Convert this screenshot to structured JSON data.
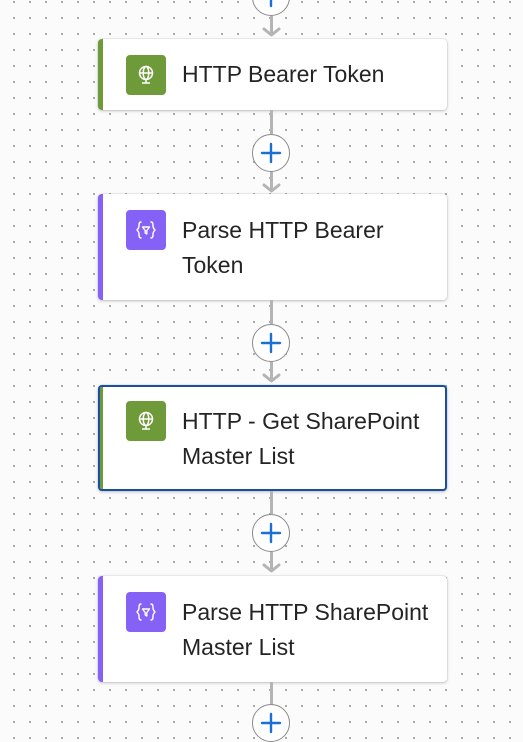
{
  "colors": {
    "http_accent": "#6f9a3a",
    "http_icon_bg": "#6f9a3a",
    "parse_accent": "#8661f5",
    "parse_icon_bg": "#8661f5",
    "selected_border": "#1a4fa0",
    "add_icon": "#1a6fd8",
    "connector": "#b4b4b4"
  },
  "flow": {
    "steps": [
      {
        "title": "HTTP Bearer Token",
        "icon": "globe-icon",
        "kind": "http"
      },
      {
        "title": "Parse HTTP Bearer Token",
        "icon": "json-parse-icon",
        "kind": "parse"
      },
      {
        "title": "HTTP - Get SharePoint Master List",
        "icon": "globe-icon",
        "kind": "http",
        "selected": true
      },
      {
        "title": "Parse HTTP SharePoint Master List",
        "icon": "json-parse-icon",
        "kind": "parse"
      }
    ],
    "insert_step_icon": "plus-icon"
  }
}
